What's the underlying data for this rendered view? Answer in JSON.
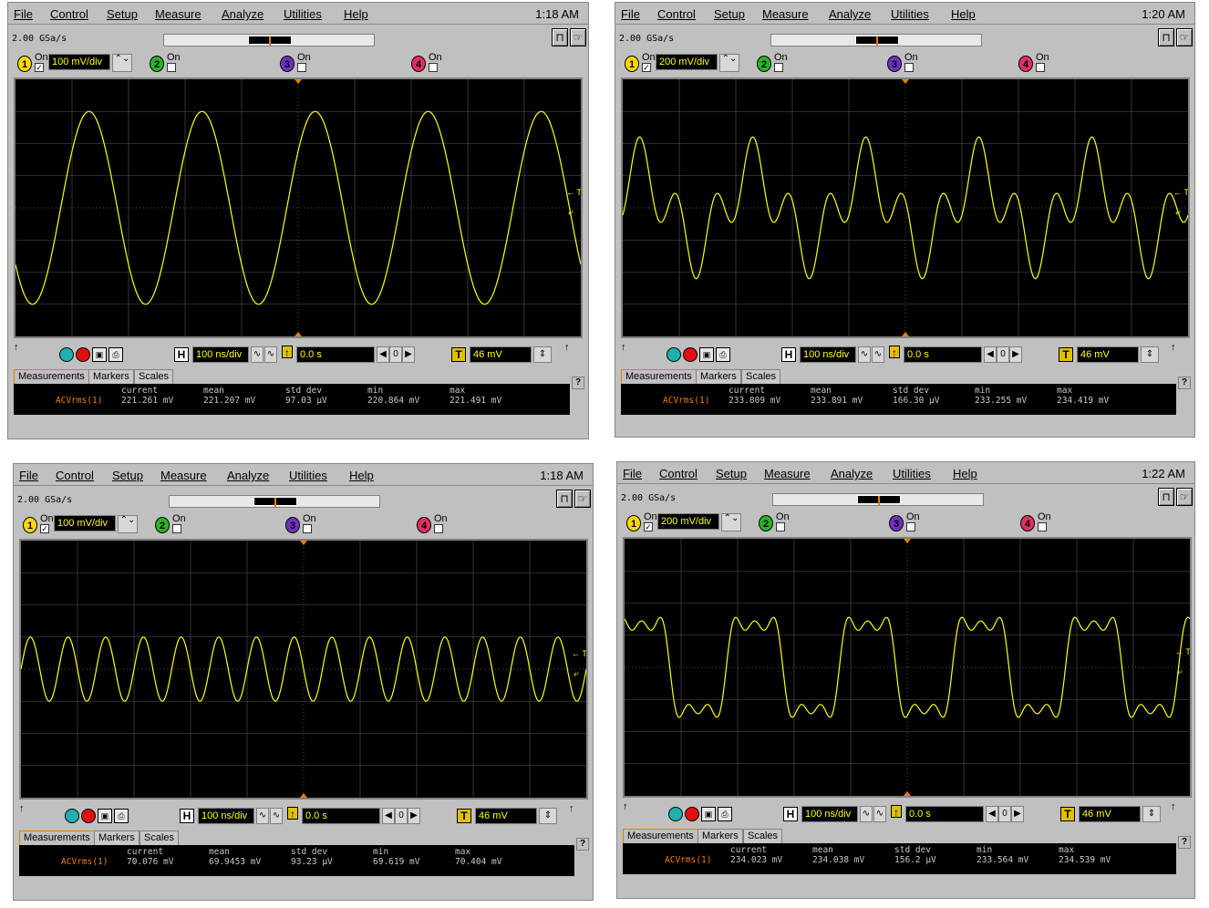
{
  "menu": [
    "File",
    "Control",
    "Setup",
    "Measure",
    "Analyze",
    "Utilities",
    "Help"
  ],
  "colors": {
    "trace": "#ffff00",
    "screen": "#000000",
    "grid": "#555555",
    "label": "#f08000"
  },
  "windows": [
    {
      "clock": "1:18 AM",
      "rate": "2.00 GSa/s",
      "ch1_scale": "100 mV/div",
      "h_scale": "100 ns/div",
      "delay": "0.0 s",
      "trig_level": "46 mV",
      "trace": {
        "type": "sine",
        "cycles": 5,
        "amp_div": 3.0,
        "phase": 0.6
      },
      "meas": {
        "label": "ACVrms(1)",
        "current": "221.261 mV",
        "mean": "221.207 mV",
        "std_dev": "97.03 µV",
        "min": "220.864 mV",
        "max": "221.491 mV"
      }
    },
    {
      "clock": "1:20 AM",
      "rate": "2.00 GSa/s",
      "ch1_scale": "200 mV/div",
      "h_scale": "100 ns/div",
      "delay": "0.0 s",
      "trig_level": "46 mV",
      "trace": {
        "type": "twohump",
        "cycles": 5,
        "amp_div": 2.1,
        "phase": 0.1
      },
      "meas": {
        "label": "ACVrms(1)",
        "current": "233.809 mV",
        "mean": "233.891 mV",
        "std_dev": "166.30 µV",
        "min": "233.255 mV",
        "max": "234.419 mV"
      }
    },
    {
      "clock": "1:18 AM",
      "rate": "2.00 GSa/s",
      "ch1_scale": "100 mV/div",
      "h_scale": "100 ns/div",
      "delay": "0.0 s",
      "trig_level": "46 mV",
      "trace": {
        "type": "sine",
        "cycles": 15,
        "amp_div": 1.0,
        "phase": 0.0
      },
      "meas": {
        "label": "ACVrms(1)",
        "current": "70.076 mV",
        "mean": "69.9453 mV",
        "std_dev": "93.23 µV",
        "min": "69.619 mV",
        "max": "70.404 mV"
      }
    },
    {
      "clock": "1:22 AM",
      "rate": "2.00 GSa/s",
      "ch1_scale": "200 mV/div",
      "h_scale": "100 ns/div",
      "delay": "0.0 s",
      "trig_level": "46 mV",
      "trace": {
        "type": "square",
        "cycles": 5,
        "amp_div": 1.5,
        "phase": 0.1
      },
      "meas": {
        "label": "ACVrms(1)",
        "current": "234.023 mV",
        "mean": "234.038 mV",
        "std_dev": "156.2 µV",
        "min": "233.564 mV",
        "max": "234.539 mV"
      }
    }
  ],
  "labels": {
    "on": "On",
    "ch1": "1",
    "ch2": "2",
    "ch3": "3",
    "ch4": "4",
    "h": "H",
    "t": "T",
    "tab_meas": "Measurements",
    "tab_markers": "Markers",
    "tab_scales": "Scales",
    "hdr_current": "current",
    "hdr_mean": "mean",
    "hdr_std": "std dev",
    "hdr_min": "min",
    "hdr_max": "max",
    "help": "?"
  }
}
